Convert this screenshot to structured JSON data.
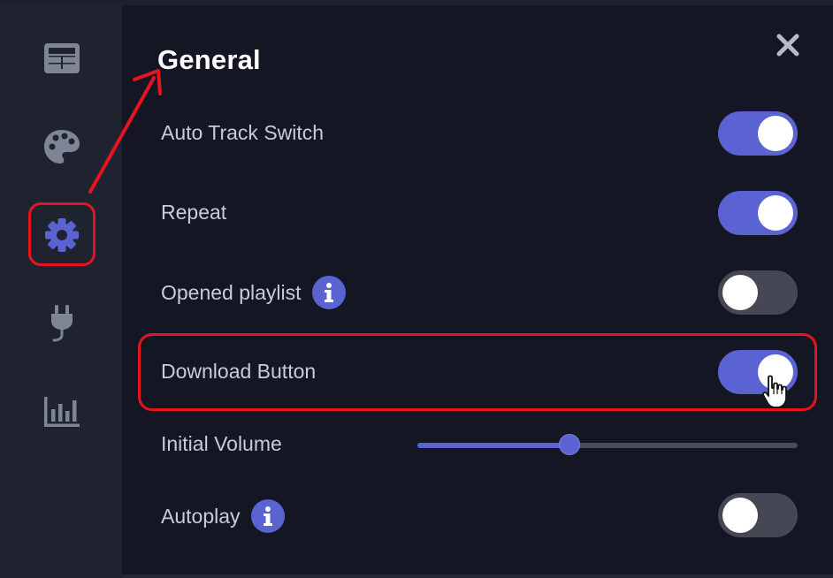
{
  "sidebar": {
    "items": [
      {
        "icon": "dashboard-icon",
        "active": false
      },
      {
        "icon": "palette-icon",
        "active": false
      },
      {
        "icon": "gear-icon",
        "active": true
      },
      {
        "icon": "plug-icon",
        "active": false
      },
      {
        "icon": "bar-chart-icon",
        "active": false
      }
    ]
  },
  "panel": {
    "title": "General",
    "close_icon": "close-icon",
    "settings": {
      "auto_track_switch": {
        "label": "Auto Track Switch",
        "on": true
      },
      "repeat": {
        "label": "Repeat",
        "on": true
      },
      "opened_playlist": {
        "label": "Opened playlist",
        "on": false,
        "info_icon": "info-icon",
        "info_glyph": "i"
      },
      "download_button": {
        "label": "Download Button",
        "on": true
      },
      "initial_volume": {
        "label": "Initial Volume",
        "value_fraction": 0.4
      },
      "autoplay": {
        "label": "Autoplay",
        "on": false,
        "info_icon": "info-icon",
        "info_glyph": "i"
      }
    }
  },
  "colors": {
    "accent": "#5b63d3",
    "sidebar_bg": "#1f232f",
    "panel_bg": "#151624",
    "icon_inactive": "#7f8594",
    "annotation": "#e5141f"
  }
}
